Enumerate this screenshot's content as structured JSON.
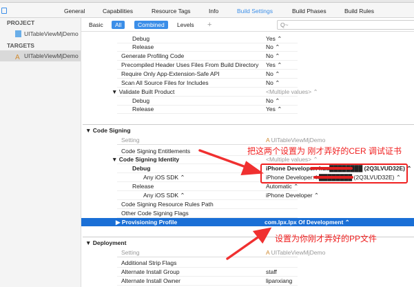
{
  "tabs": [
    "General",
    "Capabilities",
    "Resource Tags",
    "Info",
    "Build Settings",
    "Build Phases",
    "Build Rules"
  ],
  "active_tab": "Build Settings",
  "sidebar": {
    "project_header": "PROJECT",
    "project": "UITableViewMjDemo",
    "targets_header": "TARGETS",
    "target": "UITableViewMjDemo"
  },
  "filter": {
    "basic": "Basic",
    "all": "All",
    "combined": "Combined",
    "levels": "Levels",
    "add": "+",
    "search_placeholder": "Q~"
  },
  "rows_top": [
    {
      "name": "Debug",
      "value": "Yes ⌃",
      "indent": 1
    },
    {
      "name": "Release",
      "value": "No ⌃",
      "indent": 1
    },
    {
      "name": "Generate Profiling Code",
      "value": "No ⌃",
      "indent": 0
    },
    {
      "name": "Precompiled Header Uses Files From Build Directory",
      "value": "Yes ⌃",
      "indent": 0
    },
    {
      "name": "Require Only App-Extension-Safe API",
      "value": "No ⌃",
      "indent": 0
    },
    {
      "name": "Scan All Source Files for Includes",
      "value": "No ⌃",
      "indent": 0
    },
    {
      "name": "▼ Validate Built Product",
      "value": "<Multiple values> ⌃",
      "indent": -1,
      "gray": true
    },
    {
      "name": "Debug",
      "value": "No ⌃",
      "indent": 1
    },
    {
      "name": "Release",
      "value": "Yes ⌃",
      "indent": 1
    }
  ],
  "code_signing": {
    "title": "Code Signing",
    "setting_label": "Setting",
    "target_label": "UITableViewMjDemo",
    "rows": [
      {
        "name": "Code Signing Entitlements",
        "value": "",
        "indent": 0
      },
      {
        "name": "▼ Code Signing Identity",
        "value": "<Multiple values> ⌃",
        "indent": -1,
        "bold": true,
        "gray": true
      },
      {
        "name": "Debug",
        "value": "iPhone Developer: hua████████ (2Q3LVUD32E) ⌃",
        "indent": 1,
        "bold": true
      },
      {
        "name": "Any iOS SDK ⌃",
        "value": "iPhone Developer: h████████ (2Q3LVUD32E) ⌃",
        "indent": 2
      },
      {
        "name": "Release",
        "value": "Automatic ⌃",
        "indent": 1
      },
      {
        "name": "Any iOS SDK ⌃",
        "value": "iPhone Developer ⌃",
        "indent": 2
      },
      {
        "name": "Code Signing Resource Rules Path",
        "value": "",
        "indent": 0
      },
      {
        "name": "Other Code Signing Flags",
        "value": "",
        "indent": 0
      }
    ],
    "provisioning": {
      "name": "▶ Provisioning Profile",
      "value": "com.lpx.lpx Of Development ⌃"
    }
  },
  "deployment": {
    "title": "Deployment",
    "setting_label": "Setting",
    "target_label": "UITableViewMjDemo",
    "rows": [
      {
        "name": "Additional Strip Flags",
        "value": ""
      },
      {
        "name": "Alternate Install Group",
        "value": "staff"
      },
      {
        "name": "Alternate Install Owner",
        "value": "lipanxiang"
      }
    ]
  },
  "annotations": {
    "cer_note": "把这两个设置为 刚才弄好的CER 调试证书",
    "pp_note": "设置为你刚才弄好的PP文件"
  }
}
